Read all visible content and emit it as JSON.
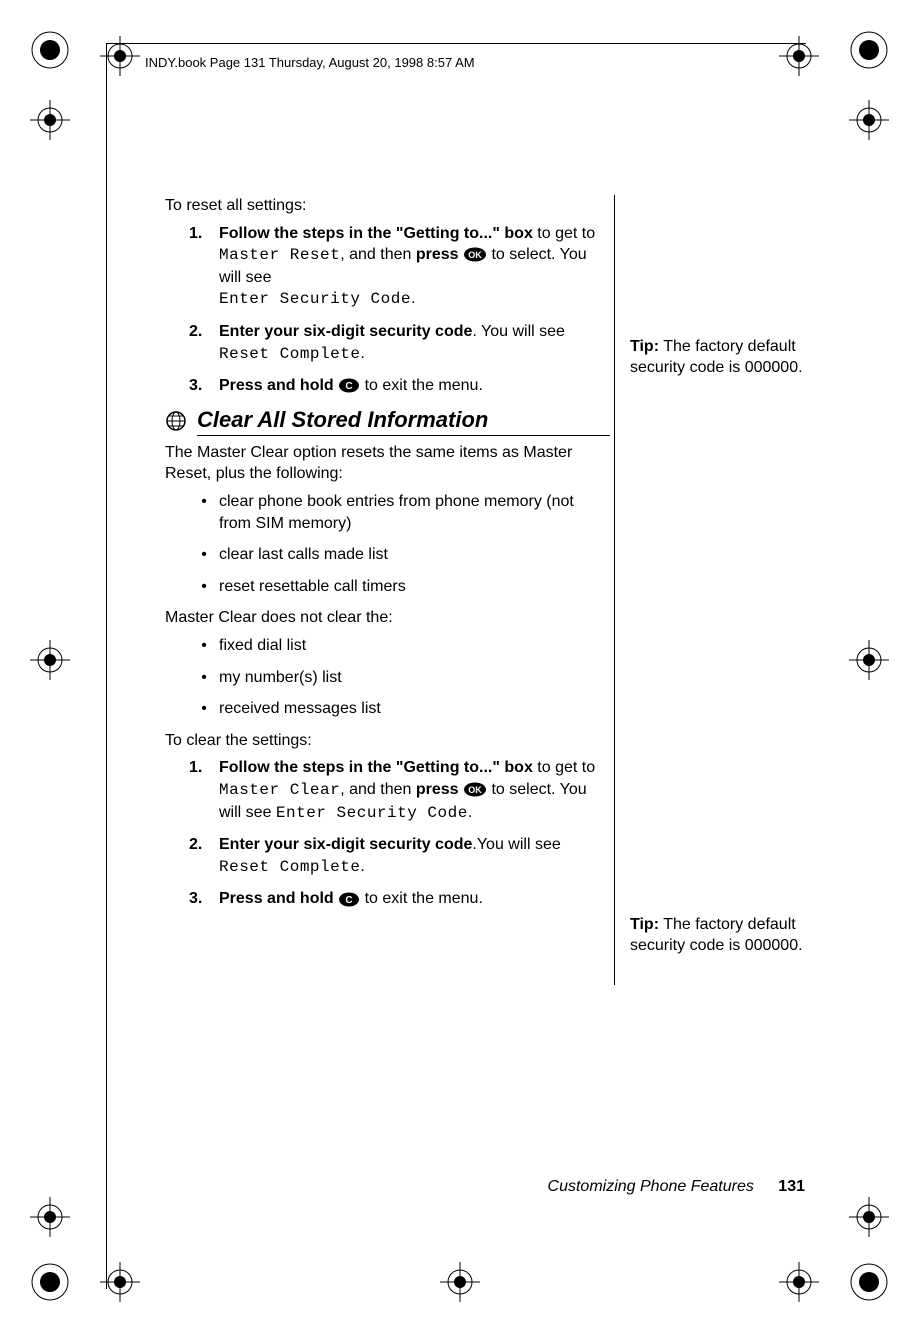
{
  "header": "INDY.book  Page 131  Thursday, August 20, 1998  8:57 AM",
  "intro1": "To reset all settings:",
  "stepsA": {
    "s1_a": "Follow the steps in the \"Getting to...\" box",
    "s1_b": " to get to ",
    "s1_lcd1": "Master Reset",
    "s1_c": ", and then ",
    "s1_press": "press",
    "s1_d": " to select. You will see ",
    "s1_lcd2": "Enter Security Code",
    "s1_e": ".",
    "s2_a": "Enter your six-digit security code",
    "s2_b": ". You will see ",
    "s2_lcd": "Reset Complete",
    "s2_c": ".",
    "s3_a": "Press and hold",
    "s3_b": " to exit the menu."
  },
  "heading": "Clear All Stored Information",
  "para1": "The Master Clear option resets the same items as Master Reset, plus the following:",
  "list1": [
    "clear phone book entries from phone memory (not from SIM memory)",
    "clear last calls made list",
    "reset resettable call timers"
  ],
  "para2": "Master Clear does not clear the:",
  "list2": [
    "fixed dial list",
    "my number(s) list",
    "received messages list"
  ],
  "intro2": "To clear the settings:",
  "stepsB": {
    "s1_a": "Follow the steps in the \"Getting to...\" box",
    "s1_b": " to get to ",
    "s1_lcd1": "Master Clear",
    "s1_c": ", and then ",
    "s1_press": "press",
    "s1_d": " to select. You will see ",
    "s1_lcd2": "Enter Security Code",
    "s1_e": ".",
    "s2_a": "Enter your six-digit security code",
    "s2_b": ".You will see ",
    "s2_lcd": "Reset Complete",
    "s2_c": ".",
    "s3_a": "Press and hold",
    "s3_b": " to exit the menu."
  },
  "tip1": {
    "label": "Tip:",
    "text": " The factory default security code is 000000."
  },
  "tip2": {
    "label": "Tip:",
    "text": " The factory default security code is 000000."
  },
  "footer": {
    "chapter": "Customizing Phone Features",
    "page": "131"
  }
}
